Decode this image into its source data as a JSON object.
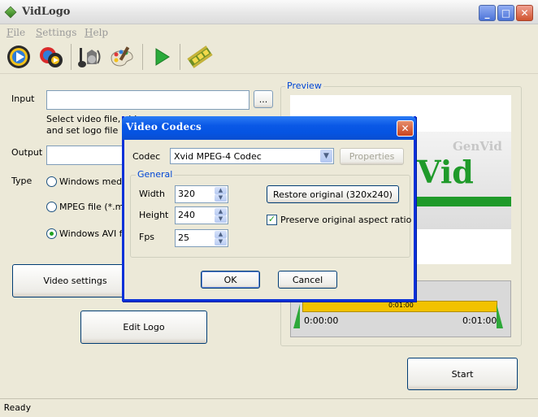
{
  "window": {
    "title": "VidLogo",
    "min": "_",
    "max": "□",
    "close": "✕"
  },
  "menu": [
    {
      "label": "File",
      "key": "F",
      "rest": "ile"
    },
    {
      "label": "Settings",
      "key": "S",
      "rest": "ettings"
    },
    {
      "label": "Help",
      "key": "H",
      "rest": "elp"
    }
  ],
  "toolbar": {
    "icons": [
      "media-player-icon",
      "video-convert-icon",
      "music-icon",
      "paint-palette-icon",
      "play-icon",
      "film-reel-icon"
    ]
  },
  "form": {
    "input_label": "Input",
    "input_value": "",
    "browse_label": "...",
    "input_hint_line1": "Select video file, vid",
    "input_hint_line2": "and set logo file",
    "output_label": "Output",
    "output_value": "",
    "type_label": "Type",
    "type_options": [
      "Windows media",
      "MPEG file (*.mpg",
      "Windows AVI file"
    ],
    "type_selected": 2,
    "video_settings_label": "Video settings",
    "edit_logo_label": "Edit Logo",
    "start_label": "Start"
  },
  "preview": {
    "title": "Preview",
    "logo_text": "Vid",
    "watermark_text": "GenVid",
    "time_total": "0:01:00",
    "time_start": "0:00:00",
    "time_end": "0:01:00"
  },
  "status": {
    "text": "Ready"
  },
  "dialog": {
    "title": "Video Codecs",
    "close": "✕",
    "codec_label": "Codec",
    "codec_value": "Xvid MPEG-4 Codec",
    "properties_label": "Properties",
    "general_title": "General",
    "width_label": "Width",
    "width_value": "320",
    "height_label": "Height",
    "height_value": "240",
    "fps_label": "Fps",
    "fps_value": "25",
    "restore_label": "Restore original (320x240)",
    "preserve_label": "Preserve original aspect ratio",
    "preserve_checked": true,
    "ok_label": "OK",
    "cancel_label": "Cancel"
  },
  "colors": {
    "accent": "#0a58e6",
    "preview_green": "#1f9a2a",
    "timeline_yellow": "#f2c200"
  }
}
